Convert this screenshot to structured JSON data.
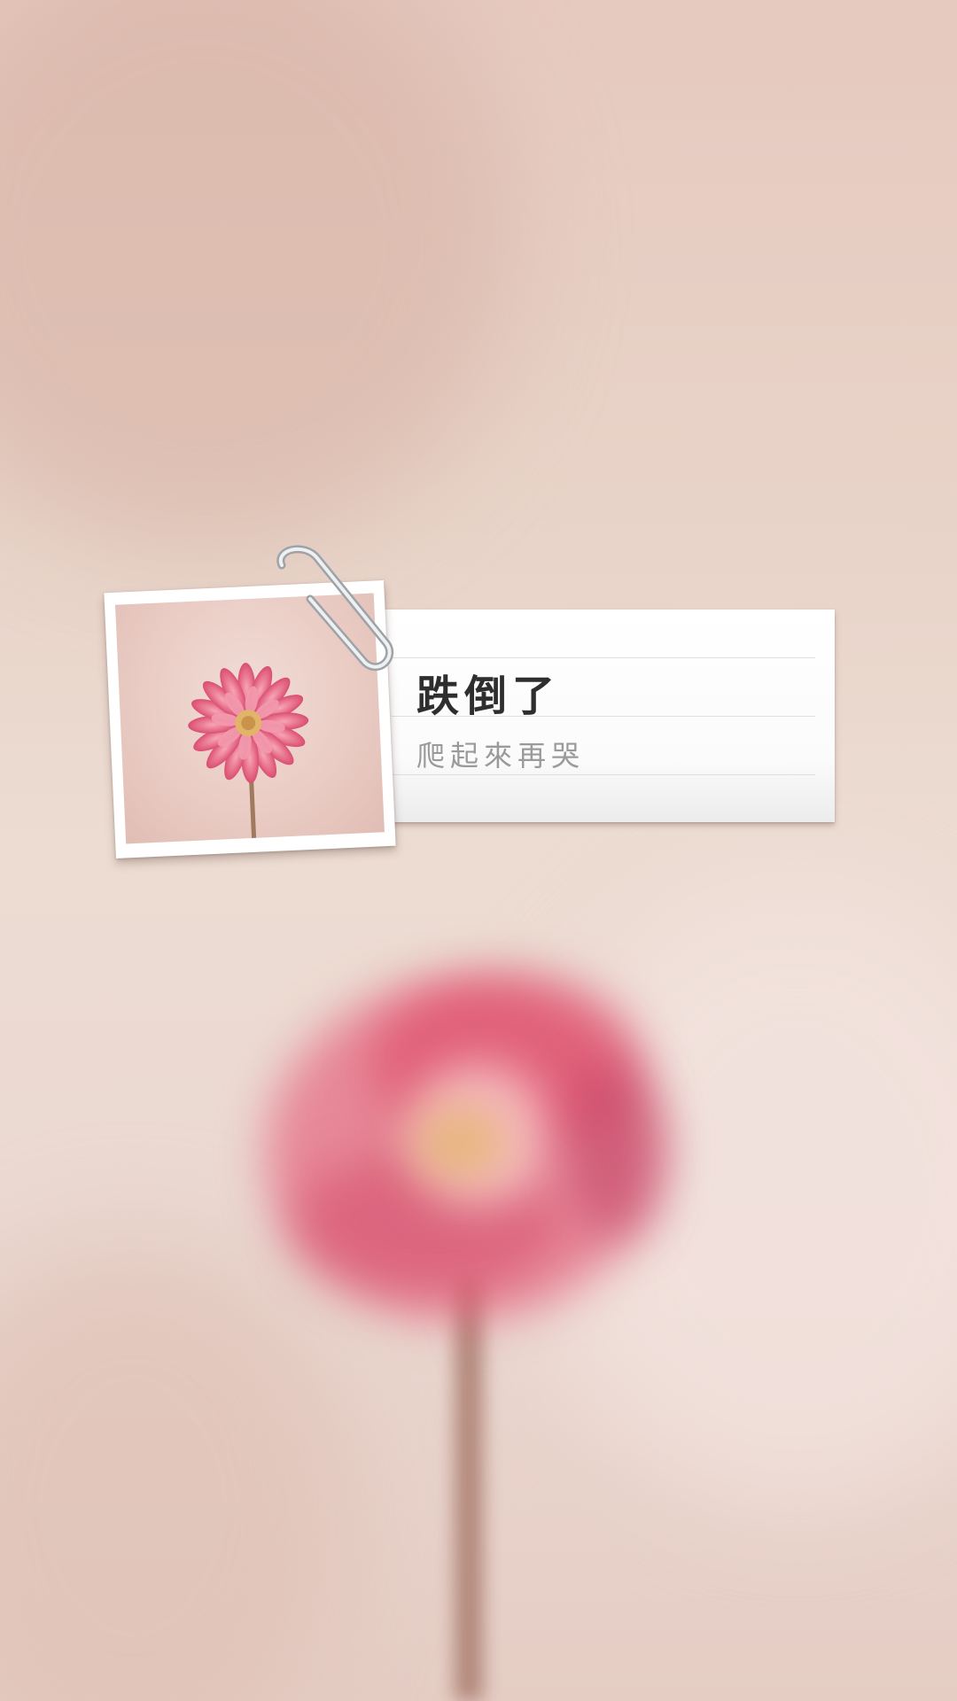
{
  "note": {
    "title": "跌倒了",
    "subtitle": "爬起來再哭"
  },
  "icons": {
    "paperclip": "paperclip-icon",
    "flower": "flower-icon"
  },
  "colors": {
    "background": "#e8d3c8",
    "flower_pink": "#e0607a",
    "flower_center": "#e2b46a",
    "title_text": "#2e2e2e",
    "subtitle_text": "#9a9a9a"
  }
}
